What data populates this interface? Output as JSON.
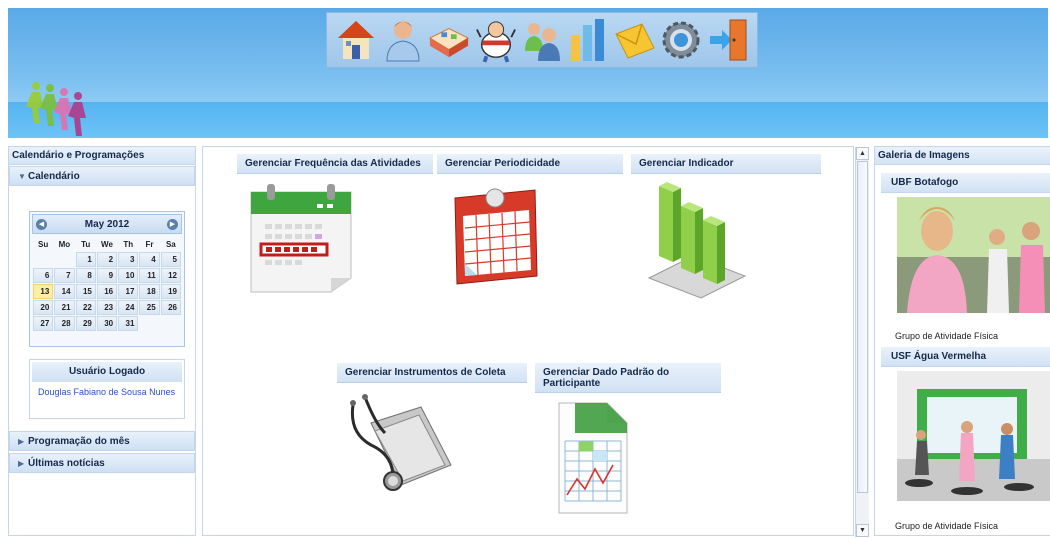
{
  "toolbar": {
    "icons": [
      "home-icon",
      "user-icon",
      "map-icon",
      "mascot-icon",
      "group-icon",
      "bar-chart-icon",
      "mail-icon",
      "settings-icon",
      "exit-icon"
    ]
  },
  "left_panel": {
    "title": "Calendário e Programações",
    "calendar_section": "Calendário",
    "calendar": {
      "month_label": "May 2012",
      "weekdays": [
        "Su",
        "Mo",
        "Tu",
        "We",
        "Th",
        "Fr",
        "Sa"
      ],
      "weeks": [
        [
          "",
          "",
          "1",
          "2",
          "3",
          "4",
          "5"
        ],
        [
          "6",
          "7",
          "8",
          "9",
          "10",
          "11",
          "12"
        ],
        [
          "13",
          "14",
          "15",
          "16",
          "17",
          "18",
          "19"
        ],
        [
          "20",
          "21",
          "22",
          "23",
          "24",
          "25",
          "26"
        ],
        [
          "27",
          "28",
          "29",
          "30",
          "31",
          "",
          ""
        ]
      ],
      "today": "13"
    },
    "user": {
      "title": "Usuário Logado",
      "name": "Douglas Fabiano de Sousa Nunes"
    },
    "sections": [
      "Programação do mês",
      "Últimas notícias"
    ]
  },
  "center_panel": {
    "tiles": [
      {
        "label": "Gerenciar Frequência das Atividades",
        "icon": "calendar-green-icon"
      },
      {
        "label": "Gerenciar Periodicidade",
        "icon": "calendar-red-icon"
      },
      {
        "label": "Gerenciar Indicador",
        "icon": "bar-chart-3d-icon"
      },
      {
        "label": "Gerenciar Instrumentos de Coleta",
        "icon": "stethoscope-folder-icon"
      },
      {
        "label": "Gerenciar Dado Padrão do Participante",
        "icon": "spreadsheet-chart-icon"
      }
    ]
  },
  "right_panel": {
    "title": "Galeria de Imagens",
    "galleries": [
      {
        "title": "UBF Botafogo",
        "caption": "Grupo de Atividade Física"
      },
      {
        "title": "USF Água Vermelha",
        "caption": "Grupo de Atividade Física"
      }
    ]
  }
}
